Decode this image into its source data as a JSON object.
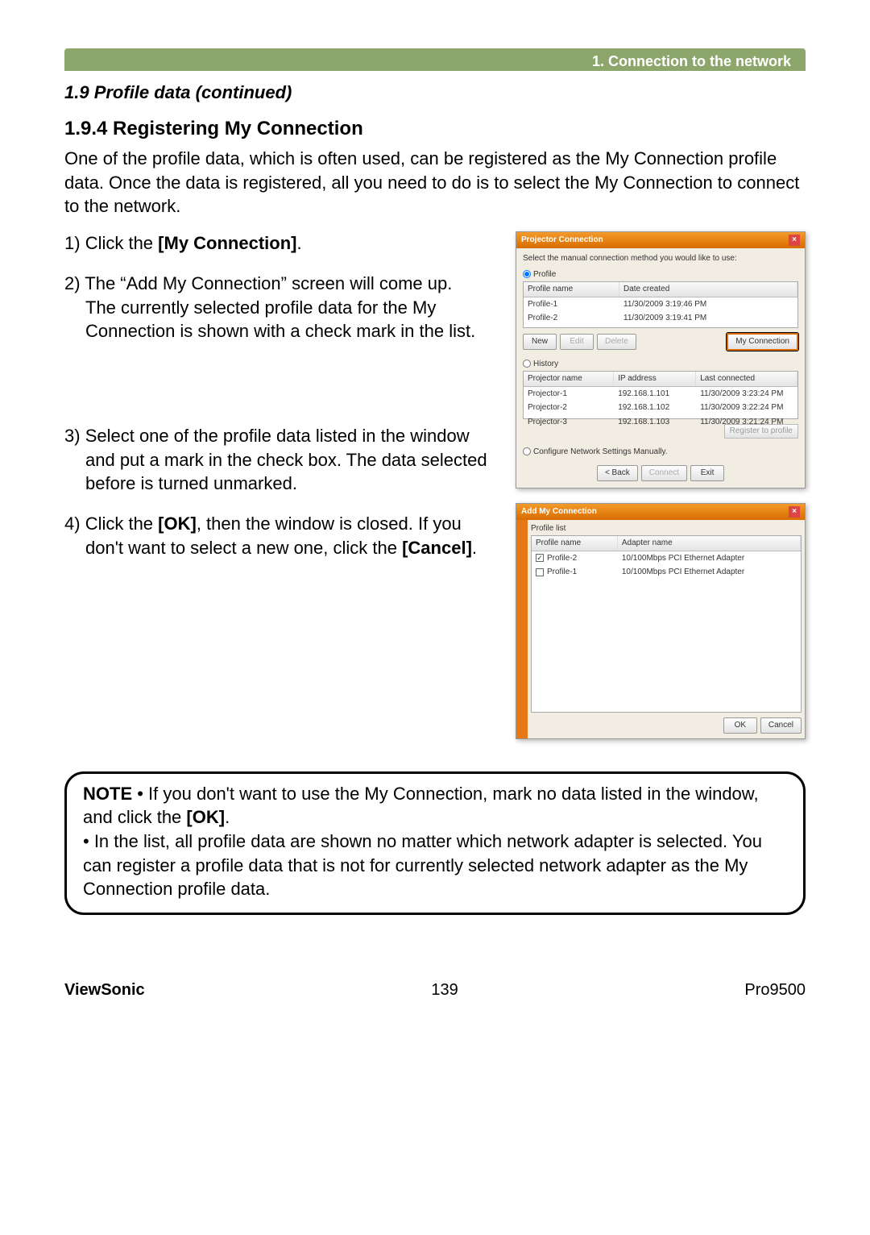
{
  "header": {
    "chapter": "1. Connection to the network"
  },
  "section_ref": "1.9 Profile data (continued)",
  "subsection": "1.9.4 Registering My Connection",
  "intro": "One of the profile data, which is often used, can be registered as the My Connection profile data. Once the data is registered, all you need to do is to select the My Connection to connect to the network.",
  "steps": {
    "s1": {
      "prefix": "1) ",
      "a": "Click the ",
      "b": "[My Connection]",
      "c": "."
    },
    "s2": {
      "prefix": "2) ",
      "a": "The “Add My Connection” screen will come up.",
      "b": "The currently selected profile data for the My Connection is shown with a check mark in the list."
    },
    "s3": {
      "prefix": "3) ",
      "a": "Select one of the profile data listed in the window and put a mark in the check box. The data selected before is turned unmarked."
    },
    "s4": {
      "prefix": "4) ",
      "a": "Click the ",
      "b": "[OK]",
      "c": ", then the window is closed. If you don't want to select a new one, click the ",
      "d": "[Cancel]",
      "e": "."
    }
  },
  "note": {
    "label": "NOTE",
    "line1a": " • If you don't want to use the My Connection, mark no data listed in the window, and click the ",
    "line1b": "[OK]",
    "line1c": ".",
    "line2": "• In the list, all profile data are shown no matter which network adapter is selected. You can register a profile data that is not for currently selected network adapter as the My Connection profile data."
  },
  "footer": {
    "brand": "ViewSonic",
    "page": "139",
    "model": "Pro9500"
  },
  "shot1": {
    "title": "Projector Connection",
    "instruction": "Select the manual connection method you would like to use:",
    "radio_profile": "Profile",
    "radio_history": "History",
    "radio_manual": "Configure Network Settings Manually.",
    "profile_headers": {
      "name": "Profile name",
      "date": "Date created"
    },
    "profiles": [
      {
        "name": "Profile-1",
        "date": "11/30/2009 3:19:46 PM"
      },
      {
        "name": "Profile-2",
        "date": "11/30/2009 3:19:41 PM"
      }
    ],
    "buttons": {
      "new": "New",
      "edit": "Edit",
      "delete": "Delete",
      "myconn": "My Connection"
    },
    "history_headers": {
      "name": "Projector name",
      "ip": "IP address",
      "last": "Last connected"
    },
    "history": [
      {
        "name": "Projector-1",
        "ip": "192.168.1.101",
        "last": "11/30/2009 3:23:24 PM"
      },
      {
        "name": "Projector-2",
        "ip": "192.168.1.102",
        "last": "11/30/2009 3:22:24 PM"
      },
      {
        "name": "Projector-3",
        "ip": "192.168.1.103",
        "last": "11/30/2009 3:21:24 PM"
      }
    ],
    "register": "Register to profile",
    "nav": {
      "back": "< Back",
      "connect": "Connect",
      "exit": "Exit"
    }
  },
  "shot2": {
    "title": "Add My Connection",
    "list_label": "Profile list",
    "headers": {
      "name": "Profile name",
      "adapter": "Adapter name"
    },
    "rows": [
      {
        "checked": true,
        "name": "Profile-2",
        "adapter": "10/100Mbps PCI Ethernet Adapter"
      },
      {
        "checked": false,
        "name": "Profile-1",
        "adapter": "10/100Mbps PCI Ethernet Adapter"
      }
    ],
    "buttons": {
      "ok": "OK",
      "cancel": "Cancel"
    }
  }
}
